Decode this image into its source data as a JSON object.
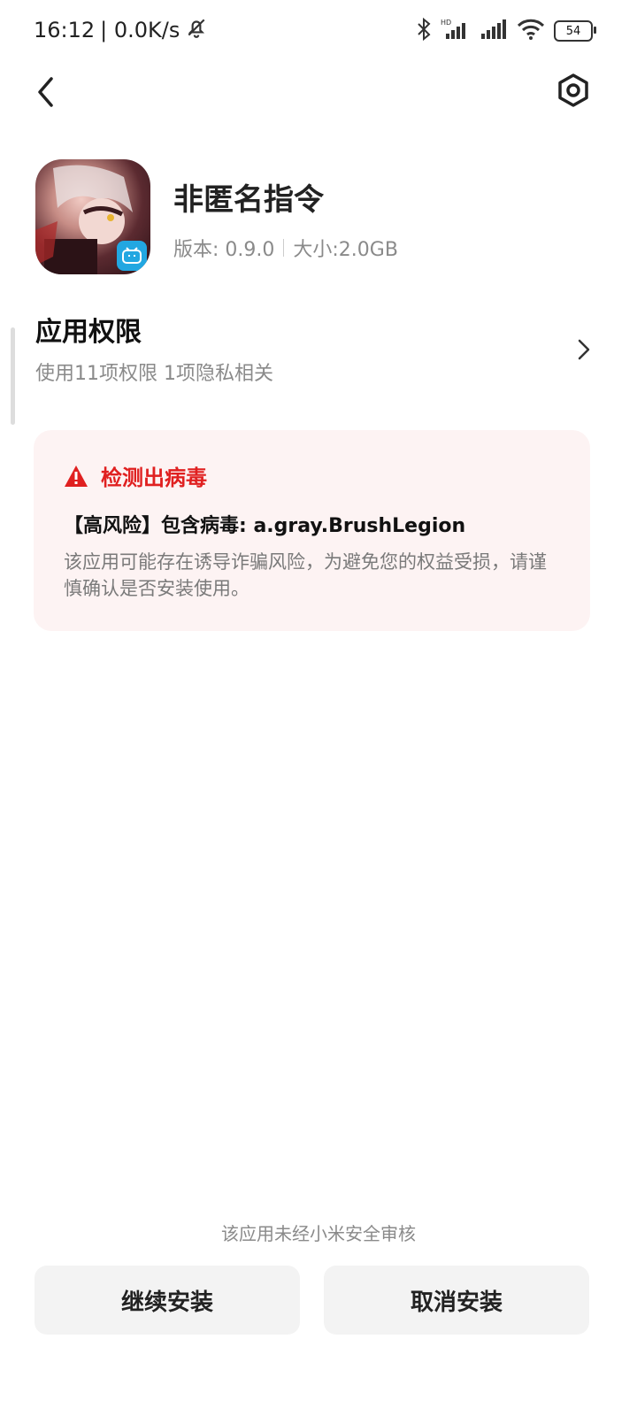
{
  "status_bar": {
    "time": "16:12",
    "network_speed": "| 0.0K/s",
    "battery": "54",
    "icons": [
      "dnd-off-icon",
      "bluetooth-icon",
      "hd-signal-icon",
      "signal-icon",
      "wifi-icon",
      "battery-icon"
    ]
  },
  "top_bar": {
    "back_icon": "back-chevron-icon",
    "settings_icon": "settings-icon"
  },
  "app": {
    "name": "非匿名指令",
    "version_label": "版本: 0.9.0",
    "size_label": "大小:2.0GB",
    "icon": "app-icon"
  },
  "permissions": {
    "title": "应用权限",
    "summary": "使用11项权限 1项隐私相关"
  },
  "virus_warning": {
    "title": "检测出病毒",
    "risk_text": "【高风险】包含病毒: a.gray.BrushLegion",
    "description": "该应用可能存在诱导诈骗风险，为避免您的权益受损，请谨慎确认是否安装使用。",
    "accent_color": "#e02020",
    "background_color": "#fdf3f3"
  },
  "footer": {
    "note": "该应用未经小米安全审核",
    "continue_label": "继续安装",
    "cancel_label": "取消安装"
  }
}
